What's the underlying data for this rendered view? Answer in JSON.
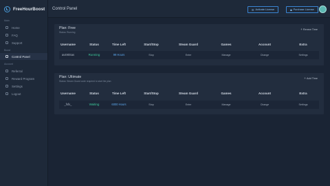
{
  "app": {
    "brand": "FreeHourBoost",
    "page_title": "Control Panel"
  },
  "sidebar": {
    "sections": [
      {
        "label": "Main",
        "items": [
          {
            "label": "Home",
            "icon": "home-icon"
          },
          {
            "label": "FAQ",
            "icon": "question-icon"
          },
          {
            "label": "Support",
            "icon": "support-icon"
          }
        ]
      },
      {
        "label": "Boost",
        "items": [
          {
            "label": "Control Panel",
            "icon": "control-panel-icon",
            "active": true
          }
        ]
      },
      {
        "label": "Account",
        "items": [
          {
            "label": "Referral",
            "icon": "share-icon"
          },
          {
            "label": "Reward Program",
            "icon": "gift-icon"
          },
          {
            "label": "Settings",
            "icon": "gear-icon"
          },
          {
            "label": "Logout",
            "icon": "logout-icon"
          }
        ]
      }
    ]
  },
  "header": {
    "activate_label": "Activate License",
    "purchase_label": "Purchase License",
    "activate_icon": "list-icon",
    "purchase_icon": "cart-icon"
  },
  "columns": [
    "Username",
    "Status",
    "Time Left",
    "Start/Stop",
    "Steam Guard",
    "Games",
    "Account",
    "Extra"
  ],
  "plans": [
    {
      "title": "Plan: Free",
      "status_line": "Status: Running",
      "action_label": "Renew Time",
      "row": {
        "username": "as490Sas",
        "status": "Running",
        "time_left": "99 Hours",
        "start_stop": "Stop",
        "steam_guard": "Enter",
        "games": "Manage",
        "account": "Change",
        "extra": "Settings"
      }
    },
    {
      "title": "Plan: Ultimate",
      "status_line": "Status: Steam Guard code required to start the plan",
      "action_label": "Add Time",
      "row": {
        "username": "_fsfx_",
        "status": "Waiting",
        "time_left": "6000 Hours",
        "start_stop": "Stop",
        "steam_guard": "Enter",
        "games": "Manage",
        "account": "Change",
        "extra": "Settings"
      }
    }
  ],
  "colors": {
    "accent": "#3a86d4",
    "status_green": "#3dc99a",
    "time_blue": "#5eaaf0",
    "background": "#1a2434"
  }
}
